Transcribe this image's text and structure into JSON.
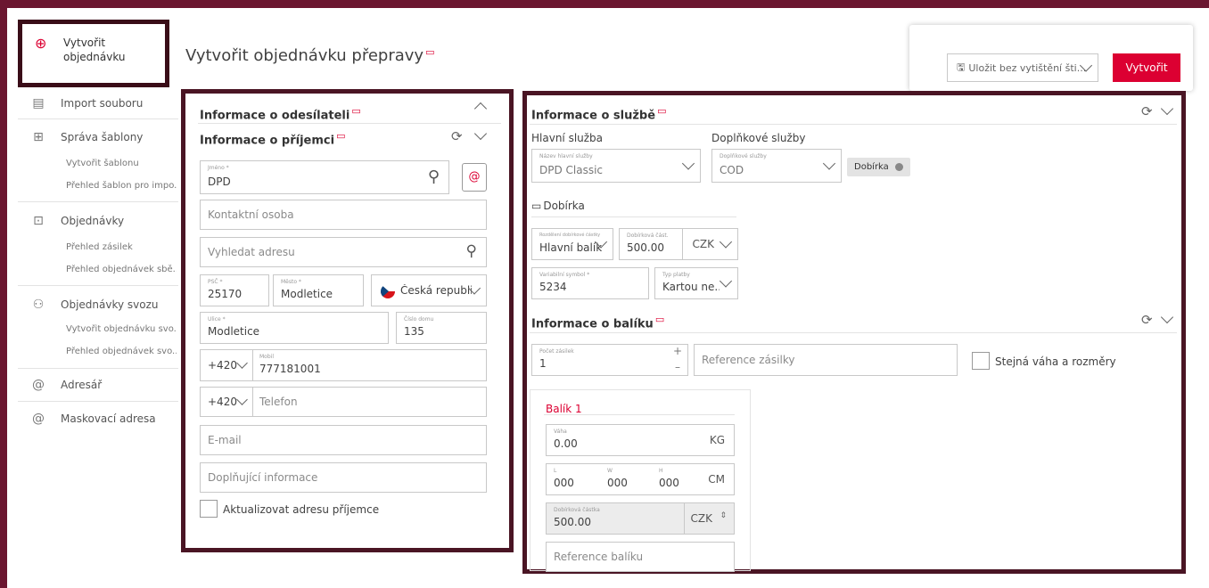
{
  "sidebar": {
    "create_order": [
      "Vytvořit",
      "objednávku"
    ],
    "import": "Import souboru",
    "templates": "Správa šablony",
    "templates_create": "Vytvořit šablonu",
    "templates_overview": "Přehled šablon pro impo...",
    "orders": "Objednávky",
    "orders_shipments": "Přehled zásilek",
    "orders_overview": "Přehled objednávek sbě...",
    "pickup": "Objednávky svozu",
    "pickup_create": "Vytvořit objednávku svo...",
    "pickup_overview": "Přehled objednávek svo...",
    "address_book": "Adresář",
    "mask_address": "Maskovací adresa"
  },
  "header": {
    "title": "Vytvořit objednávku přepravy",
    "save_label": "Uložit bez vytištění šti...",
    "create_label": "Vytvořit"
  },
  "sender": {
    "title": "Informace o odesílateli"
  },
  "recipient": {
    "title": "Informace o příjemci",
    "name_label": "Jméno *",
    "name_value": "DPD",
    "contact_ph": "Kontaktní osoba",
    "search_ph": "Vyhledat adresu",
    "zip_label": "PSČ *",
    "zip_value": "25170",
    "city_label": "Město *",
    "city_value": "Modletice",
    "country_value": "Česká republika",
    "street_label": "Ulice *",
    "street_value": "Modletice",
    "house_label": "Číslo domu",
    "house_value": "135",
    "mobile_prefix": "+420",
    "mobile_label": "Mobil",
    "mobile_value": "777181001",
    "phone_prefix": "+420",
    "phone_ph": "Telefon",
    "email_ph": "E-mail",
    "extra_ph": "Doplňující informace",
    "update_label": "Aktualizovat adresu příjemce"
  },
  "service": {
    "title": "Informace o službě",
    "main_label": "Hlavní služba",
    "extra_label": "Doplňkové služby",
    "main_field_label": "Název hlavní služby",
    "main_value": "DPD Classic",
    "extra_field_label": "Doplňkové služby",
    "extra_value": "COD",
    "tag": "Dobírka",
    "cod_title": "Dobírka",
    "cod_split_label": "Rozdělení dobírkové částky",
    "cod_split_value": "Hlavní balík",
    "cod_amount_label": "Dobírková část.",
    "cod_amount_value": "500.00",
    "currency": "CZK",
    "vs_label": "Variabilní symbol *",
    "vs_value": "5234",
    "pay_label": "Typ platby",
    "pay_value": "Kartou ne..."
  },
  "package": {
    "title": "Informace o balíku",
    "count_label": "Počet zásilek",
    "count_value": "1",
    "ref_ph": "Reference zásilky",
    "same_label": "Stejná váha a rozměry",
    "box_title": "Balík 1",
    "weight_label": "Váha",
    "weight_value": "0.00",
    "weight_unit": "KG",
    "l_label": "L",
    "w_label": "W",
    "h_label": "H",
    "l_value": "000",
    "w_value": "000",
    "h_value": "000",
    "dim_unit": "CM",
    "cod_label": "Dobírková částka",
    "cod_value": "500.00",
    "cod_currency": "CZK",
    "pkg_ref_ph": "Reference balíku"
  },
  "colors": {
    "brand": "#dc0032",
    "frame": "#4a1524"
  }
}
